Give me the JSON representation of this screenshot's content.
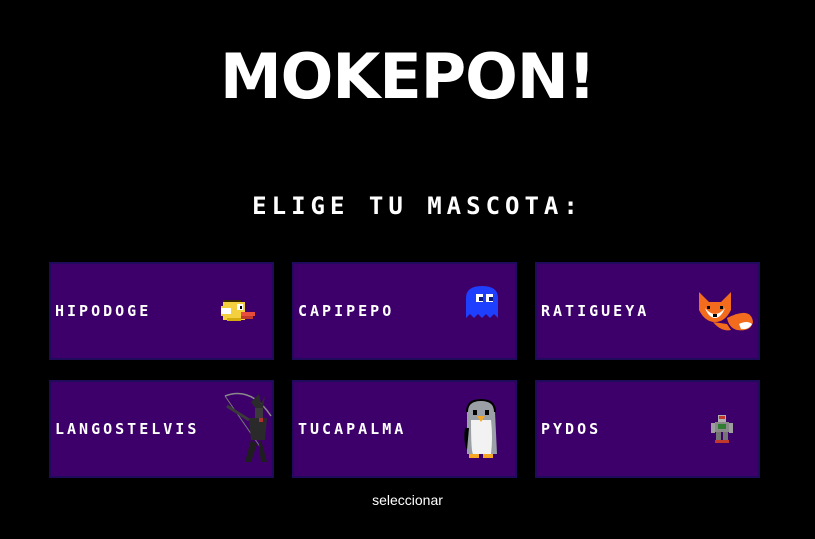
{
  "header": {
    "title": "MOKEPON!"
  },
  "main": {
    "subtitle": "ELIGE TU MASCOTA:",
    "pets": [
      {
        "name": "HIPODOGE",
        "icon": "flappy-bird-icon"
      },
      {
        "name": "CAPIPEPO",
        "icon": "ghost-icon"
      },
      {
        "name": "RATIGUEYA",
        "icon": "fox-icon"
      },
      {
        "name": "LANGOSTELVIS",
        "icon": "archer-icon"
      },
      {
        "name": "TUCAPALMA",
        "icon": "penguin-icon"
      },
      {
        "name": "PYDOS",
        "icon": "robot-icon"
      }
    ],
    "select_label": "seleccionar"
  },
  "colors": {
    "background": "#000000",
    "card": "#3d006b",
    "card_border": "#1f0a5c",
    "text": "#ffffff"
  }
}
